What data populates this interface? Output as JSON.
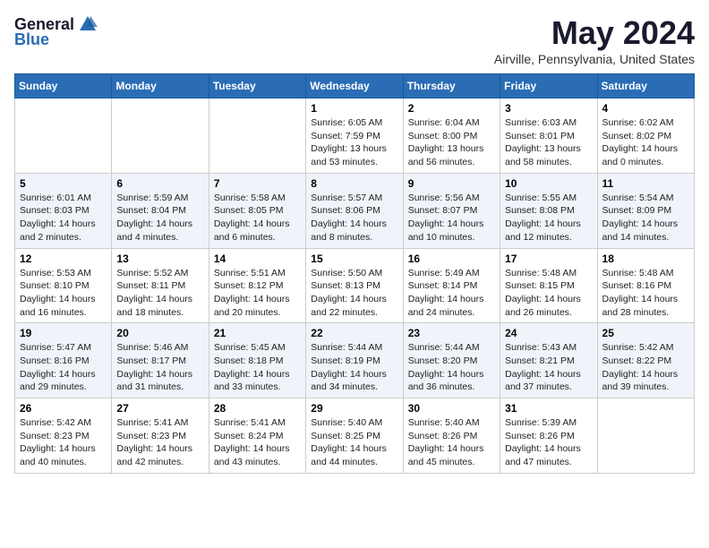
{
  "header": {
    "logo_general": "General",
    "logo_blue": "Blue",
    "month_title": "May 2024",
    "location": "Airville, Pennsylvania, United States"
  },
  "weekdays": [
    "Sunday",
    "Monday",
    "Tuesday",
    "Wednesday",
    "Thursday",
    "Friday",
    "Saturday"
  ],
  "weeks": [
    [
      {
        "day": "",
        "info": ""
      },
      {
        "day": "",
        "info": ""
      },
      {
        "day": "",
        "info": ""
      },
      {
        "day": "1",
        "info": "Sunrise: 6:05 AM\nSunset: 7:59 PM\nDaylight: 13 hours\nand 53 minutes."
      },
      {
        "day": "2",
        "info": "Sunrise: 6:04 AM\nSunset: 8:00 PM\nDaylight: 13 hours\nand 56 minutes."
      },
      {
        "day": "3",
        "info": "Sunrise: 6:03 AM\nSunset: 8:01 PM\nDaylight: 13 hours\nand 58 minutes."
      },
      {
        "day": "4",
        "info": "Sunrise: 6:02 AM\nSunset: 8:02 PM\nDaylight: 14 hours\nand 0 minutes."
      }
    ],
    [
      {
        "day": "5",
        "info": "Sunrise: 6:01 AM\nSunset: 8:03 PM\nDaylight: 14 hours\nand 2 minutes."
      },
      {
        "day": "6",
        "info": "Sunrise: 5:59 AM\nSunset: 8:04 PM\nDaylight: 14 hours\nand 4 minutes."
      },
      {
        "day": "7",
        "info": "Sunrise: 5:58 AM\nSunset: 8:05 PM\nDaylight: 14 hours\nand 6 minutes."
      },
      {
        "day": "8",
        "info": "Sunrise: 5:57 AM\nSunset: 8:06 PM\nDaylight: 14 hours\nand 8 minutes."
      },
      {
        "day": "9",
        "info": "Sunrise: 5:56 AM\nSunset: 8:07 PM\nDaylight: 14 hours\nand 10 minutes."
      },
      {
        "day": "10",
        "info": "Sunrise: 5:55 AM\nSunset: 8:08 PM\nDaylight: 14 hours\nand 12 minutes."
      },
      {
        "day": "11",
        "info": "Sunrise: 5:54 AM\nSunset: 8:09 PM\nDaylight: 14 hours\nand 14 minutes."
      }
    ],
    [
      {
        "day": "12",
        "info": "Sunrise: 5:53 AM\nSunset: 8:10 PM\nDaylight: 14 hours\nand 16 minutes."
      },
      {
        "day": "13",
        "info": "Sunrise: 5:52 AM\nSunset: 8:11 PM\nDaylight: 14 hours\nand 18 minutes."
      },
      {
        "day": "14",
        "info": "Sunrise: 5:51 AM\nSunset: 8:12 PM\nDaylight: 14 hours\nand 20 minutes."
      },
      {
        "day": "15",
        "info": "Sunrise: 5:50 AM\nSunset: 8:13 PM\nDaylight: 14 hours\nand 22 minutes."
      },
      {
        "day": "16",
        "info": "Sunrise: 5:49 AM\nSunset: 8:14 PM\nDaylight: 14 hours\nand 24 minutes."
      },
      {
        "day": "17",
        "info": "Sunrise: 5:48 AM\nSunset: 8:15 PM\nDaylight: 14 hours\nand 26 minutes."
      },
      {
        "day": "18",
        "info": "Sunrise: 5:48 AM\nSunset: 8:16 PM\nDaylight: 14 hours\nand 28 minutes."
      }
    ],
    [
      {
        "day": "19",
        "info": "Sunrise: 5:47 AM\nSunset: 8:16 PM\nDaylight: 14 hours\nand 29 minutes."
      },
      {
        "day": "20",
        "info": "Sunrise: 5:46 AM\nSunset: 8:17 PM\nDaylight: 14 hours\nand 31 minutes."
      },
      {
        "day": "21",
        "info": "Sunrise: 5:45 AM\nSunset: 8:18 PM\nDaylight: 14 hours\nand 33 minutes."
      },
      {
        "day": "22",
        "info": "Sunrise: 5:44 AM\nSunset: 8:19 PM\nDaylight: 14 hours\nand 34 minutes."
      },
      {
        "day": "23",
        "info": "Sunrise: 5:44 AM\nSunset: 8:20 PM\nDaylight: 14 hours\nand 36 minutes."
      },
      {
        "day": "24",
        "info": "Sunrise: 5:43 AM\nSunset: 8:21 PM\nDaylight: 14 hours\nand 37 minutes."
      },
      {
        "day": "25",
        "info": "Sunrise: 5:42 AM\nSunset: 8:22 PM\nDaylight: 14 hours\nand 39 minutes."
      }
    ],
    [
      {
        "day": "26",
        "info": "Sunrise: 5:42 AM\nSunset: 8:23 PM\nDaylight: 14 hours\nand 40 minutes."
      },
      {
        "day": "27",
        "info": "Sunrise: 5:41 AM\nSunset: 8:23 PM\nDaylight: 14 hours\nand 42 minutes."
      },
      {
        "day": "28",
        "info": "Sunrise: 5:41 AM\nSunset: 8:24 PM\nDaylight: 14 hours\nand 43 minutes."
      },
      {
        "day": "29",
        "info": "Sunrise: 5:40 AM\nSunset: 8:25 PM\nDaylight: 14 hours\nand 44 minutes."
      },
      {
        "day": "30",
        "info": "Sunrise: 5:40 AM\nSunset: 8:26 PM\nDaylight: 14 hours\nand 45 minutes."
      },
      {
        "day": "31",
        "info": "Sunrise: 5:39 AM\nSunset: 8:26 PM\nDaylight: 14 hours\nand 47 minutes."
      },
      {
        "day": "",
        "info": ""
      }
    ]
  ]
}
